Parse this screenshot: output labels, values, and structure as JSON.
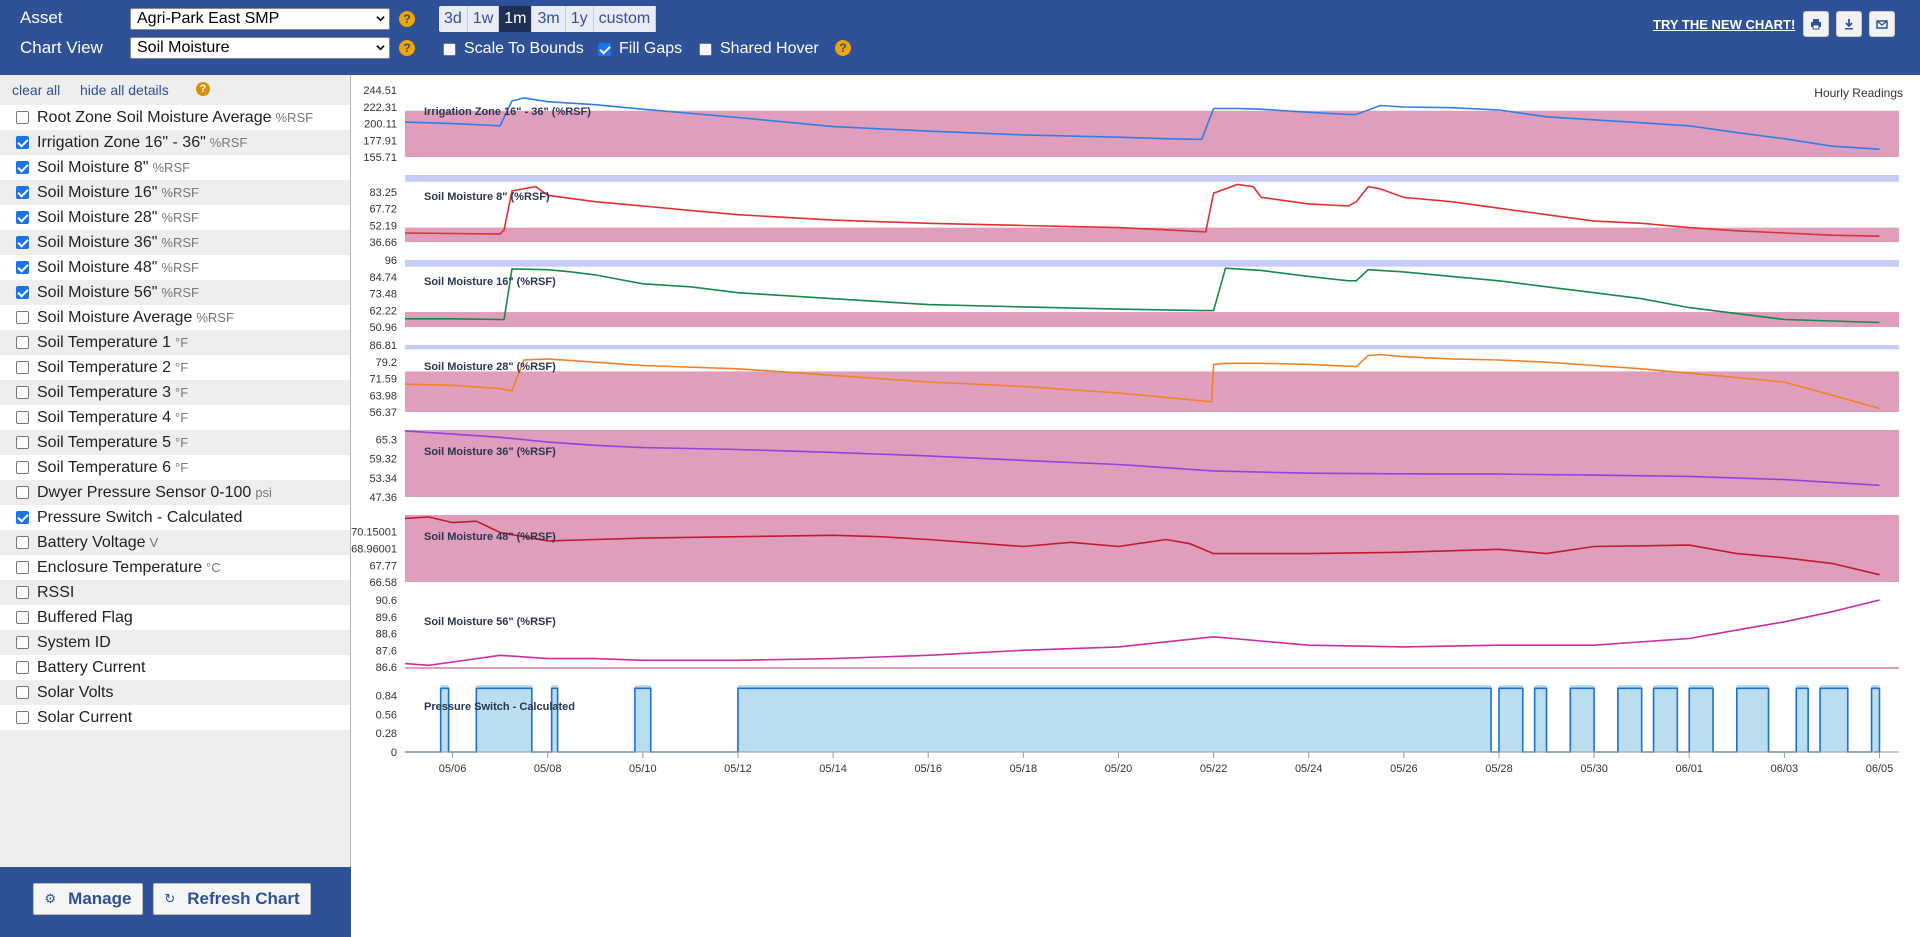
{
  "toolbar": {
    "asset_label": "Asset",
    "asset_value": "Agri-Park East SMP",
    "view_label": "Chart View",
    "view_value": "Soil Moisture",
    "help_glyph": "?",
    "ranges": [
      "3d",
      "1w",
      "1m",
      "3m",
      "1y",
      "custom"
    ],
    "active_range": "1m",
    "scale_to_bounds": "Scale To Bounds",
    "fill_gaps": "Fill Gaps",
    "shared_hover": "Shared Hover",
    "scale_to_bounds_checked": false,
    "fill_gaps_checked": true,
    "shared_hover_checked": false,
    "try_new_chart": "TRY THE NEW CHART!",
    "icons": [
      "print-icon",
      "download-icon",
      "email-icon"
    ]
  },
  "sidebar": {
    "clear_all": "clear all",
    "hide_all_details": "hide all details",
    "series": [
      {
        "label": "Root Zone Soil Moisture Average",
        "unit": "%RSF",
        "checked": false
      },
      {
        "label": "Irrigation Zone 16\" - 36\"",
        "unit": "%RSF",
        "checked": true
      },
      {
        "label": "Soil Moisture 8\"",
        "unit": "%RSF",
        "checked": true
      },
      {
        "label": "Soil Moisture 16\"",
        "unit": "%RSF",
        "checked": true
      },
      {
        "label": "Soil Moisture 28\"",
        "unit": "%RSF",
        "checked": true
      },
      {
        "label": "Soil Moisture 36\"",
        "unit": "%RSF",
        "checked": true
      },
      {
        "label": "Soil Moisture 48\"",
        "unit": "%RSF",
        "checked": true
      },
      {
        "label": "Soil Moisture 56\"",
        "unit": "%RSF",
        "checked": true
      },
      {
        "label": "Soil Moisture Average",
        "unit": "%RSF",
        "checked": false
      },
      {
        "label": "Soil Temperature 1",
        "unit": "°F",
        "checked": false
      },
      {
        "label": "Soil Temperature 2",
        "unit": "°F",
        "checked": false
      },
      {
        "label": "Soil Temperature 3",
        "unit": "°F",
        "checked": false
      },
      {
        "label": "Soil Temperature 4",
        "unit": "°F",
        "checked": false
      },
      {
        "label": "Soil Temperature 5",
        "unit": "°F",
        "checked": false
      },
      {
        "label": "Soil Temperature 6",
        "unit": "°F",
        "checked": false
      },
      {
        "label": "Dwyer Pressure Sensor 0-100",
        "unit": "psi",
        "checked": false
      },
      {
        "label": "Pressure Switch - Calculated",
        "unit": "",
        "checked": true
      },
      {
        "label": "Battery Voltage",
        "unit": "V",
        "checked": false
      },
      {
        "label": "Enclosure Temperature",
        "unit": "°C",
        "checked": false
      },
      {
        "label": "RSSI",
        "unit": "",
        "checked": false
      },
      {
        "label": "Buffered Flag",
        "unit": "",
        "checked": false
      },
      {
        "label": "System ID",
        "unit": "",
        "checked": false
      },
      {
        "label": "Battery Current",
        "unit": "",
        "checked": false
      },
      {
        "label": "Solar Volts",
        "unit": "",
        "checked": false
      },
      {
        "label": "Solar Current",
        "unit": "",
        "checked": false
      }
    ],
    "manage_label": "Manage",
    "refresh_label": "Refresh Chart"
  },
  "chart": {
    "readings_label": "Hourly Readings",
    "x_ticks": [
      "05/06",
      "05/08",
      "05/10",
      "05/12",
      "05/14",
      "05/16",
      "05/18",
      "05/20",
      "05/22",
      "05/24",
      "05/26",
      "05/28",
      "05/30",
      "06/01",
      "06/03",
      "06/05"
    ],
    "band_color": "#e09ebd",
    "upper_band_color": "#c5cdf7"
  },
  "chart_data": [
    {
      "type": "line",
      "title": "Irrigation Zone 16\" - 36\" (%RSF)",
      "color": "#2f7ee8",
      "yticks": [
        "244.51",
        "222.31",
        "200.11",
        "177.91",
        "155.71"
      ],
      "ylim": [
        155.71,
        244.51
      ],
      "band": [
        155.71,
        217
      ],
      "upper_band": null,
      "x": [
        "05/05",
        "05/06",
        "05/07",
        "05/07 06:00",
        "05/07 12:00",
        "05/08",
        "05/09",
        "05/10",
        "05/12",
        "05/14",
        "05/16",
        "05/18",
        "05/20",
        "05/21",
        "05/21 18:00",
        "05/22",
        "05/22 12:00",
        "05/23",
        "05/24",
        "05/24 20:00",
        "05/25",
        "05/25 12:00",
        "05/26",
        "05/27",
        "05/28",
        "05/29",
        "05/30",
        "05/31",
        "06/01",
        "06/02",
        "06/03",
        "06/04",
        "06/05"
      ],
      "y": [
        202,
        200,
        197,
        230,
        234,
        229,
        225,
        219,
        208,
        196,
        190,
        185,
        182,
        180,
        179,
        220,
        220,
        219,
        215,
        212,
        212,
        224,
        222,
        221,
        218,
        209,
        205,
        201,
        197,
        188,
        180,
        170,
        166
      ]
    },
    {
      "type": "line",
      "title": "Soil Moisture 8\" (%RSF)",
      "color": "#e03030",
      "yticks": [
        "83.25",
        "67.72",
        "52.19",
        "36.66"
      ],
      "ylim": [
        36.66,
        98.78
      ],
      "band": [
        36.66,
        50
      ],
      "upper_band": [
        92.5,
        98.78
      ],
      "x": [
        "05/05",
        "05/06",
        "05/07",
        "05/07 02:00",
        "05/07 06:00",
        "05/07 18:00",
        "05/08",
        "05/09",
        "05/10",
        "05/11",
        "05/12",
        "05/14",
        "05/16",
        "05/18",
        "05/20",
        "05/21",
        "05/21 20:00",
        "05/22",
        "05/22 12:00",
        "05/22 20:00",
        "05/23",
        "05/24",
        "05/24 20:00",
        "05/25",
        "05/25 06:00",
        "05/25 12:00",
        "05/26",
        "05/27",
        "05/28",
        "05/29",
        "05/30",
        "05/31",
        "06/01",
        "06/02",
        "06/03",
        "06/04",
        "06/05"
      ],
      "y": [
        45,
        44.5,
        44,
        48,
        84,
        88,
        80,
        74,
        70,
        66,
        62,
        57,
        54,
        52,
        50,
        48,
        46,
        82,
        90,
        88,
        78,
        72,
        70,
        74,
        88,
        86,
        78,
        74,
        68,
        62,
        56,
        54,
        50,
        47,
        45,
        43,
        42
      ]
    },
    {
      "type": "line",
      "title": "Soil Moisture 16\" (%RSF)",
      "color": "#168a4a",
      "yticks": [
        "96",
        "84.74",
        "73.48",
        "62.22",
        "50.96"
      ],
      "ylim": [
        50.96,
        96
      ],
      "band": [
        50.96,
        61
      ],
      "upper_band": [
        91.5,
        96
      ],
      "x": [
        "05/05",
        "05/06",
        "05/07",
        "05/07 02:00",
        "05/07 06:00",
        "05/08",
        "05/08 12:00",
        "05/09",
        "05/10",
        "05/11",
        "05/12",
        "05/14",
        "05/16",
        "05/18",
        "05/20",
        "05/21 18:00",
        "05/22",
        "05/22 06:00",
        "05/23",
        "05/24",
        "05/24 20:00",
        "05/25",
        "05/25 06:00",
        "05/25 12:00",
        "05/26",
        "05/27",
        "05/28",
        "05/29",
        "05/30",
        "05/31",
        "06/01",
        "06/02",
        "06/03",
        "06/04",
        "06/05"
      ],
      "y": [
        56.5,
        56.5,
        56,
        56,
        90,
        89.5,
        88,
        86,
        80,
        78,
        74,
        70,
        66,
        64.5,
        63,
        62,
        62,
        90.5,
        89,
        85,
        82,
        82,
        89.5,
        89,
        88,
        85,
        82,
        78,
        74,
        70,
        64,
        60,
        56,
        55,
        54
      ]
    },
    {
      "type": "line",
      "title": "Soil Moisture 28\" (%RSF)",
      "color": "#f08224",
      "yticks": [
        "86.81",
        "79.2",
        "71.59",
        "63.98",
        "56.37"
      ],
      "ylim": [
        56.37,
        86.81
      ],
      "band": [
        56.37,
        74.8
      ],
      "upper_band": [
        84.8,
        86.81
      ],
      "x": [
        "05/05",
        "05/06",
        "05/07",
        "05/07 06:00",
        "05/07 12:00",
        "05/08",
        "05/09",
        "05/10",
        "05/12",
        "05/14",
        "05/16",
        "05/18",
        "05/20",
        "05/21",
        "05/21 23:00",
        "05/22",
        "05/22 06:00",
        "05/23",
        "05/24",
        "05/25",
        "05/25 06:00",
        "05/25 12:00",
        "05/26",
        "05/27",
        "05/28",
        "05/29",
        "05/30",
        "05/31",
        "06/01",
        "06/02",
        "06/03",
        "06/04",
        "06/05"
      ],
      "y": [
        69,
        68.5,
        67,
        66,
        80,
        80.5,
        79,
        77.5,
        76,
        73,
        70,
        68,
        65,
        63,
        61,
        78,
        78.5,
        78.5,
        78,
        77,
        82,
        82.5,
        81.5,
        80.5,
        80,
        79,
        77.5,
        76,
        74,
        72,
        70,
        64,
        58
      ]
    },
    {
      "type": "line",
      "title": "Soil Moisture 36\" (%RSF)",
      "color": "#9a40e0",
      "yticks": [
        "65.3",
        "59.32",
        "53.34",
        "47.36"
      ],
      "ylim": [
        47.36,
        68.29
      ],
      "band": [
        47.36,
        68.29
      ],
      "upper_band": null,
      "x": [
        "05/05",
        "05/06",
        "05/07",
        "05/08",
        "05/09",
        "05/10",
        "05/11",
        "05/12",
        "05/14",
        "05/16",
        "05/18",
        "05/20",
        "05/22",
        "05/24",
        "05/26",
        "05/28",
        "05/30",
        "06/01",
        "06/03",
        "06/05"
      ],
      "y": [
        68,
        67,
        66,
        64.5,
        63.5,
        62.8,
        62.5,
        62.2,
        61.3,
        60.2,
        58.8,
        57.5,
        55.5,
        54.8,
        54.6,
        54.5,
        54.2,
        53.8,
        52.8,
        51
      ]
    },
    {
      "type": "line",
      "title": "Soil Moisture 48\" (%RSF)",
      "color": "#c41a2e",
      "yticks": [
        "70.15001",
        "68.96001",
        "67.77",
        "66.58"
      ],
      "ylim": [
        66.58,
        71.34
      ],
      "band": [
        66.58,
        71.34
      ],
      "upper_band": null,
      "x": [
        "05/05",
        "05/05 12:00",
        "05/06",
        "05/06 12:00",
        "05/07",
        "05/08",
        "05/09",
        "05/10",
        "05/12",
        "05/14",
        "05/15",
        "05/16",
        "05/18",
        "05/19",
        "05/20",
        "05/21",
        "05/21 12:00",
        "05/22",
        "05/24",
        "05/26",
        "05/28",
        "05/29",
        "05/30",
        "06/01",
        "06/02",
        "06/03",
        "06/04",
        "06/05"
      ],
      "y": [
        71.1,
        71.2,
        70.8,
        70.9,
        70.1,
        69.5,
        69.6,
        69.7,
        69.8,
        69.9,
        69.8,
        69.6,
        69.1,
        69.4,
        69.1,
        69.6,
        69.3,
        68.6,
        68.6,
        68.7,
        68.9,
        68.6,
        69.1,
        69.2,
        68.6,
        68.3,
        67.9,
        67.1
      ]
    },
    {
      "type": "line",
      "title": "Soil Moisture 56\" (%RSF)",
      "color": "#cc2ea0",
      "yticks": [
        "90.6",
        "89.6",
        "88.6",
        "87.6",
        "86.6"
      ],
      "ylim": [
        86.6,
        90.6
      ],
      "band": [
        86.4,
        86.6
      ],
      "upper_band": null,
      "x": [
        "05/05",
        "05/05 12:00",
        "05/06",
        "05/07",
        "05/08",
        "05/09",
        "05/10",
        "05/12",
        "05/14",
        "05/16",
        "05/18",
        "05/20",
        "05/22",
        "05/24",
        "05/26",
        "05/28",
        "05/30",
        "06/01",
        "06/02",
        "06/03",
        "06/04",
        "06/05"
      ],
      "y": [
        86.8,
        86.7,
        86.9,
        87.3,
        87.1,
        87.1,
        87.0,
        87.0,
        87.1,
        87.3,
        87.6,
        87.8,
        88.4,
        87.9,
        87.8,
        87.9,
        87.9,
        88.3,
        88.8,
        89.3,
        89.9,
        90.6
      ]
    },
    {
      "type": "area",
      "title": "Pressure Switch - Calculated",
      "color": "#1e6fd0",
      "fill": "#b9def0",
      "yticks": [
        "0.84",
        "0.56",
        "0.28",
        "0"
      ],
      "ylim": [
        0,
        1
      ],
      "on_intervals": [
        [
          "05/05 18:00",
          "05/05 22:00"
        ],
        [
          "05/06 12:00",
          "05/07 16:00"
        ],
        [
          "05/08 02:00",
          "05/08 05:00"
        ],
        [
          "05/09 20:00",
          "05/10 04:00"
        ],
        [
          "05/12",
          "05/27 20:00"
        ],
        [
          "05/28",
          "05/28 12:00"
        ],
        [
          "05/28 18:00",
          "05/29"
        ],
        [
          "05/29 12:00",
          "05/30"
        ],
        [
          "05/30 12:00",
          "05/31"
        ],
        [
          "05/31 06:00",
          "05/31 18:00"
        ],
        [
          "06/01",
          "06/01 12:00"
        ],
        [
          "06/02",
          "06/02 16:00"
        ],
        [
          "06/03 06:00",
          "06/03 12:00"
        ],
        [
          "06/03 18:00",
          "06/04 08:00"
        ],
        [
          "06/04 20:00",
          "06/05"
        ]
      ]
    }
  ]
}
